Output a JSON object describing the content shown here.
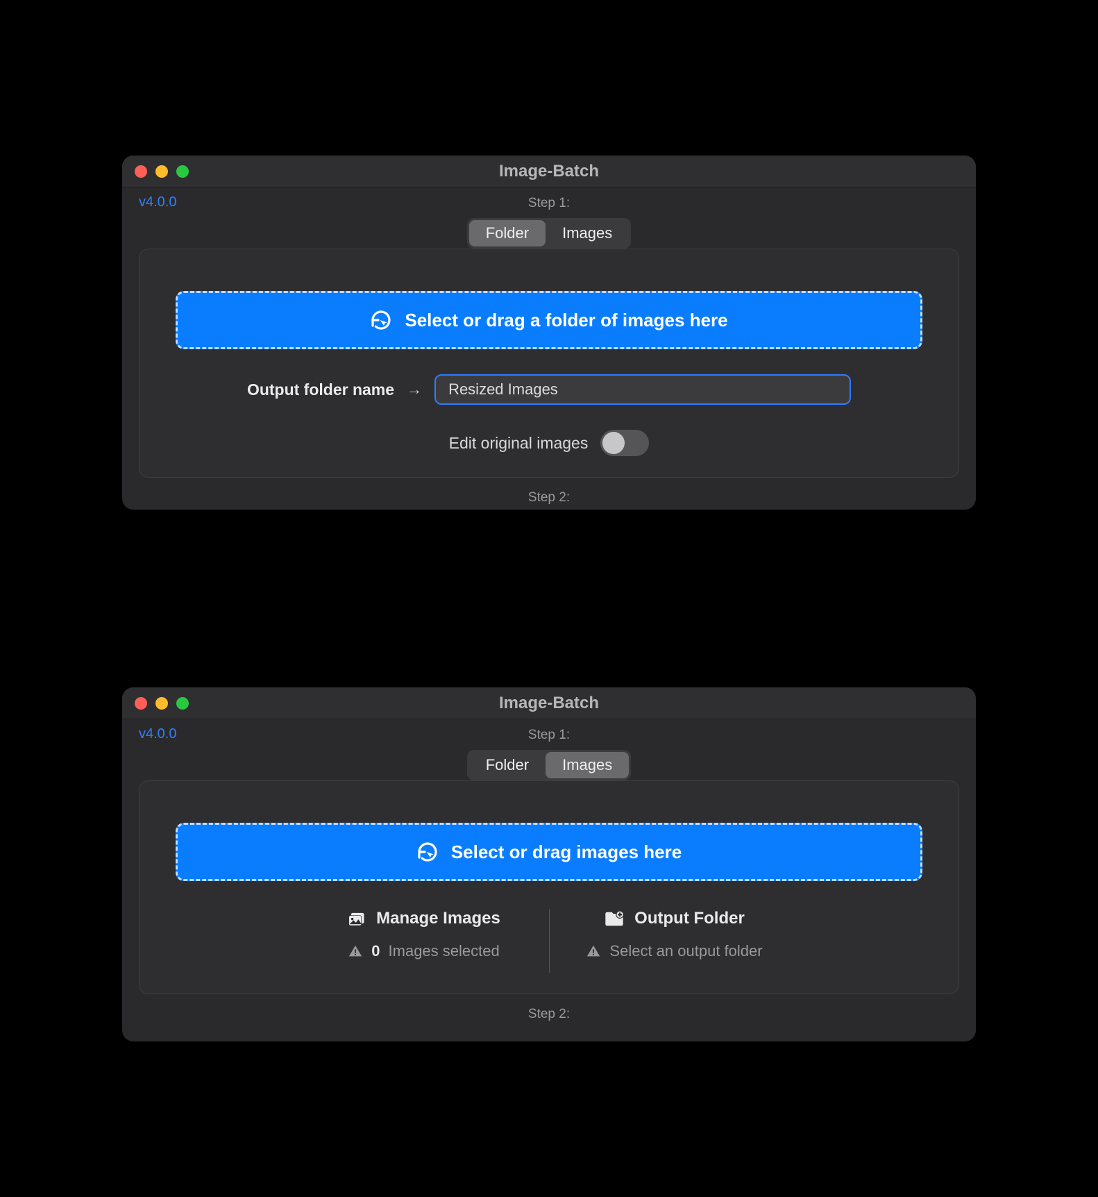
{
  "app_title": "Image-Batch",
  "version": "v4.0.0",
  "step1_label": "Step 1:",
  "step2_label": "Step 2:",
  "segmented": {
    "folder": "Folder",
    "images": "Images"
  },
  "win1": {
    "dropzone_text": "Select or drag a folder of images here",
    "output_label": "Output folder name",
    "output_value": "Resized Images",
    "toggle_label": "Edit original images",
    "toggle_on": false
  },
  "win2": {
    "dropzone_text": "Select or drag images here",
    "manage": {
      "heading": "Manage Images",
      "count": "0",
      "count_suffix": "Images selected"
    },
    "output": {
      "heading": "Output Folder",
      "sub": "Select an output folder"
    }
  }
}
